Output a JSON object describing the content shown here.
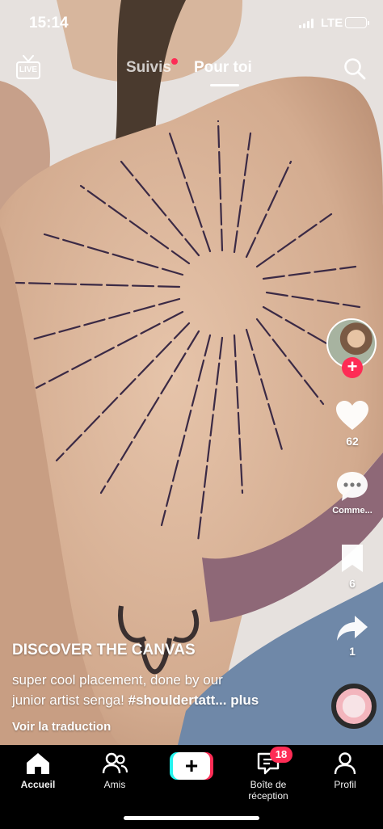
{
  "status_bar": {
    "time": "15:14",
    "network": "LTE"
  },
  "top_nav": {
    "live_label": "LIVE",
    "tabs": [
      {
        "label": "Suivis",
        "active": false,
        "has_dot": true
      },
      {
        "label": "Pour toi",
        "active": true
      }
    ]
  },
  "right_rail": {
    "likes": "62",
    "comments": "Comme...",
    "saves": "6",
    "shares": "1"
  },
  "caption": {
    "username": "DISCOVER THE CANVAS",
    "text_line1": "super cool placement, done by our",
    "text_line2_prefix": "junior artist senga! ",
    "hashtag": "#shouldertatt",
    "ellipsis_more": "... plus",
    "translate": "Voir la traduction"
  },
  "bottom_nav": {
    "items": [
      {
        "label": "Accueil",
        "icon": "home-icon",
        "active": true
      },
      {
        "label": "Amis",
        "icon": "friends-icon",
        "active": false
      },
      {
        "label": "",
        "icon": "create-plus-icon",
        "active": false
      },
      {
        "label": "Boîte de réception",
        "icon": "inbox-icon",
        "active": false,
        "badge": "18"
      },
      {
        "label": "Profil",
        "icon": "profile-icon",
        "active": false
      }
    ]
  },
  "colors": {
    "accent": "#fe2c55",
    "cyan": "#25f4ee",
    "tattoo_ink": "#3b2a45",
    "skin": "#d9b59b"
  }
}
